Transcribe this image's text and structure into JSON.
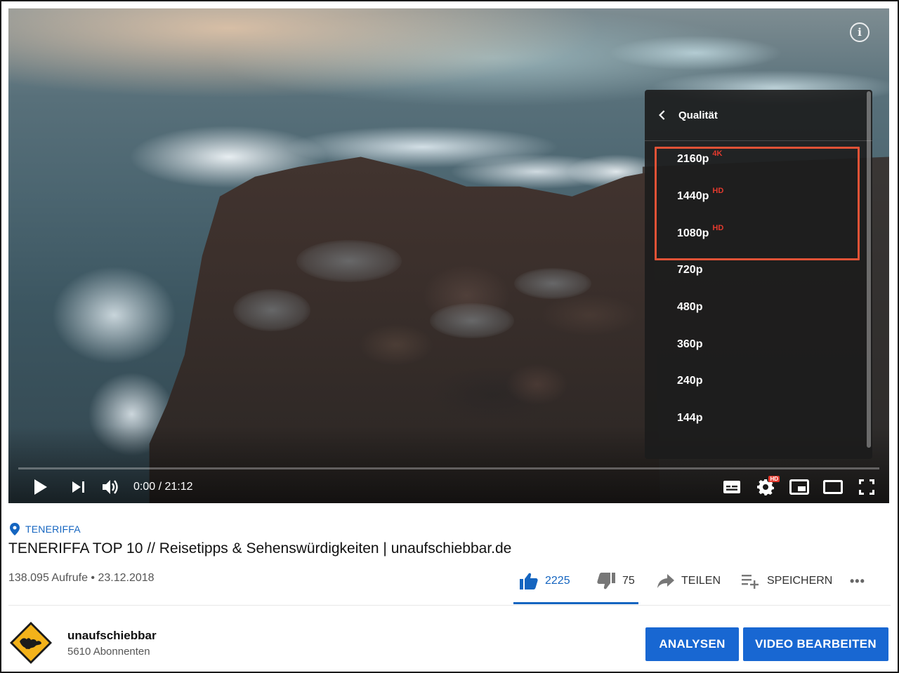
{
  "video": {
    "time_display": "0:00 / 21:12",
    "progress": 0
  },
  "quality_menu": {
    "title": "Qualität",
    "options": [
      {
        "label": "2160p",
        "badge": "4K"
      },
      {
        "label": "1440p",
        "badge": "HD"
      },
      {
        "label": "1080p",
        "badge": "HD"
      },
      {
        "label": "720p",
        "badge": ""
      },
      {
        "label": "480p",
        "badge": ""
      },
      {
        "label": "360p",
        "badge": ""
      },
      {
        "label": "240p",
        "badge": ""
      },
      {
        "label": "144p",
        "badge": ""
      }
    ],
    "highlighted": [
      "2160p",
      "1440p",
      "1080p"
    ]
  },
  "settings_badge": "HD",
  "location": "TENERIFFA",
  "title": "TENERIFFA TOP 10 // Reisetipps & Sehenswürdigkeiten | unaufschiebbar.de",
  "meta": "138.095 Aufrufe • 23.12.2018",
  "actions": {
    "likes": "2225",
    "dislikes": "75",
    "share": "TEILEN",
    "save": "SPEICHERN",
    "more": "•••"
  },
  "channel": {
    "name": "unaufschiebbar",
    "subscribers": "5610 Abonnenten"
  },
  "buttons": {
    "analytics": "ANALYSEN",
    "edit": "VIDEO BEARBEITEN"
  },
  "colors": {
    "accent_blue": "#1867d2",
    "highlight_red": "#e05236",
    "badge_red": "#e33a2e"
  }
}
